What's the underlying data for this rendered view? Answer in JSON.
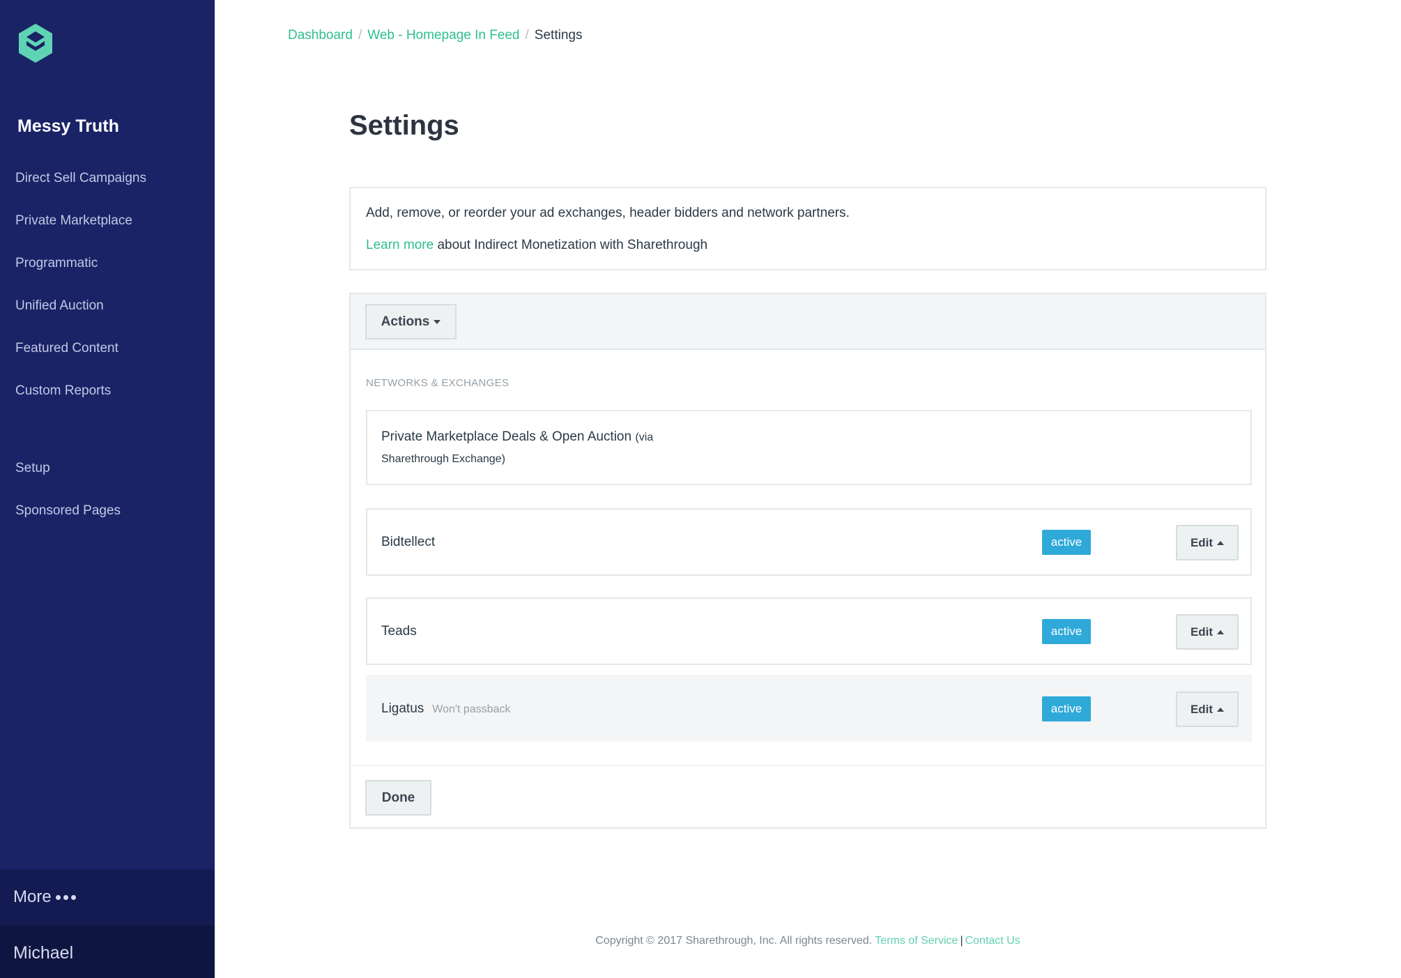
{
  "sidebar": {
    "org_name": "Messy Truth",
    "items": [
      {
        "label": "Direct Sell Campaigns"
      },
      {
        "label": "Private Marketplace"
      },
      {
        "label": "Programmatic"
      },
      {
        "label": "Unified Auction"
      },
      {
        "label": "Featured Content"
      },
      {
        "label": "Custom Reports"
      },
      {
        "label": "Setup"
      },
      {
        "label": "Sponsored Pages"
      }
    ],
    "more_label": "More",
    "user_name": "Michael"
  },
  "breadcrumb": {
    "items": [
      "Dashboard",
      "Web - Homepage In Feed"
    ],
    "separator": "/",
    "current": "Settings"
  },
  "page_title": "Settings",
  "info": {
    "line1": "Add, remove, or reorder your ad exchanges, header bidders and network partners.",
    "learn_more": "Learn more",
    "line2_rest": " about Indirect Monetization with Sharethrough"
  },
  "panel": {
    "actions_label": "Actions",
    "section_label": "NETWORKS & EXCHANGES",
    "partners": [
      {
        "name": "Private Marketplace Deals & Open Auction",
        "name_suffix": "(via",
        "sub": "Sharethrough Exchange)"
      },
      {
        "name": "Bidtellect",
        "status": "active",
        "edit_label": "Edit"
      },
      {
        "name": "Teads",
        "status": "active",
        "edit_label": "Edit"
      },
      {
        "name": "Ligatus",
        "note": "Won't passback",
        "status": "active",
        "edit_label": "Edit"
      }
    ],
    "done_label": "Done"
  },
  "footer": {
    "copyright": "Copyright © 2017 Sharethrough, Inc. All rights reserved.",
    "terms": "Terms of Service",
    "pipe": "|",
    "contact": "Contact Us"
  },
  "colors": {
    "sidebar_bg": "#1a2366",
    "accent_green": "#2fbf8f",
    "badge_blue": "#2fa9d8"
  },
  "icons": {
    "logo": "sharethrough-hexagon-logo",
    "more": "ellipsis-icon",
    "actions_caret": "caret-down-icon",
    "edit_caret": "caret-up-icon"
  }
}
